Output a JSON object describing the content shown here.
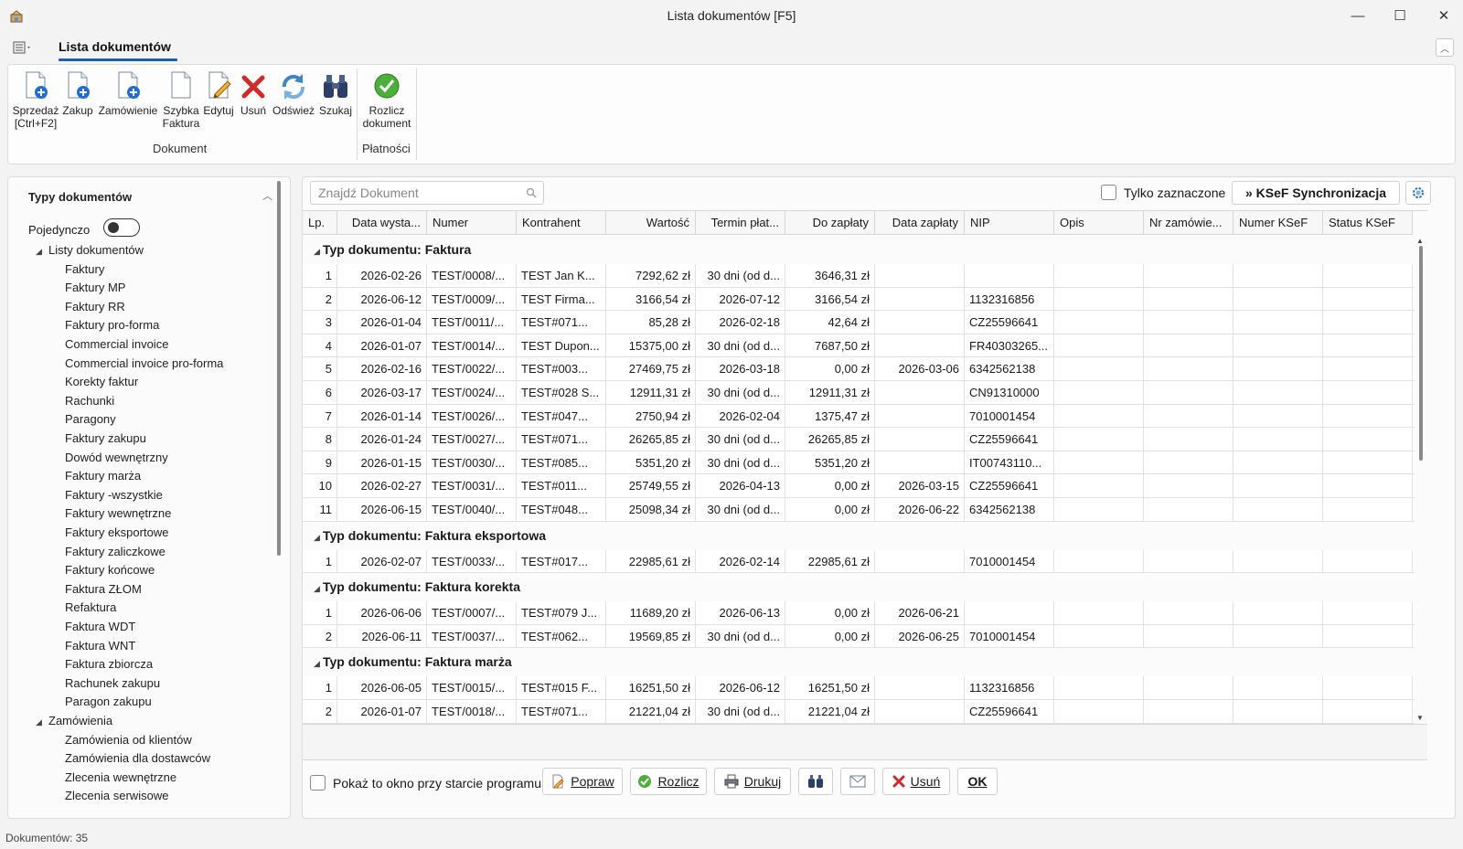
{
  "window": {
    "title": "Lista dokumentów [F5]",
    "minimize": "—",
    "maximize": "☐",
    "close": "✕"
  },
  "ribbon_tab": "Lista dokumentów",
  "ribbon": {
    "buttons": [
      {
        "label1": "Sprzedaż",
        "label2": "[Ctrl+F2]",
        "icon": "new-sale-document-icon"
      },
      {
        "label1": "Zakup",
        "label2": "",
        "icon": "new-purchase-document-icon"
      },
      {
        "label1": "Zamówienie",
        "label2": "",
        "icon": "new-order-document-icon"
      },
      {
        "label1": "Szybka",
        "label2": "Faktura",
        "icon": "blank-document-icon"
      },
      {
        "label1": "Edytuj",
        "label2": "",
        "icon": "edit-document-icon"
      },
      {
        "label1": "Usuń",
        "label2": "",
        "icon": "delete-x-icon"
      },
      {
        "label1": "Odśwież",
        "label2": "",
        "icon": "refresh-icon"
      },
      {
        "label1": "Szukaj",
        "label2": "",
        "icon": "binoculars-icon"
      },
      {
        "label1": "Rozlicz",
        "label2": "dokument",
        "icon": "green-check-icon"
      }
    ],
    "groups": {
      "document": "Dokument",
      "payments": "Płatności"
    }
  },
  "left_panel": {
    "title": "Typy dokumentów",
    "toggle_label": "Pojedynczo",
    "folders": [
      {
        "label": "Listy dokumentów",
        "items": [
          "Faktury",
          "Faktury MP",
          "Faktury RR",
          "Faktury pro-forma",
          "Commercial invoice",
          "Commercial invoice pro-forma",
          "Korekty faktur",
          "Rachunki",
          "Paragony",
          "Faktury zakupu",
          "Dowód wewnętrzny",
          "Faktury marża",
          "Faktury -wszystkie",
          "Faktury wewnętrzne",
          "Faktury eksportowe",
          "Faktury zaliczkowe",
          "Faktury końcowe",
          "Faktura ZŁOM",
          "Refaktura",
          "Faktura WDT",
          "Faktura WNT",
          "Faktura zbiorcza",
          "Rachunek zakupu",
          "Paragon zakupu"
        ]
      },
      {
        "label": "Zamówienia",
        "items": [
          "Zamówienia od klientów",
          "Zamówienia dla dostawców",
          "Zlecenia wewnętrzne",
          "Zlecenia serwisowe"
        ]
      }
    ]
  },
  "toolbar": {
    "search_placeholder": "Znajdź Dokument",
    "only_marked_label": "Tylko zaznaczone",
    "ksef_button": "» KSeF Synchronizacja"
  },
  "table": {
    "columns": [
      "Lp.",
      "Data wysta...",
      "Numer",
      "Kontrahent",
      "Wartość",
      "Termin płat...",
      "Do zapłaty",
      "Data zapłaty",
      "NIP",
      "Opis",
      "Nr zamówie...",
      "Numer KSeF",
      "Status KSeF"
    ],
    "groups": [
      {
        "title": "Typ dokumentu: Faktura",
        "rows": [
          [
            "1",
            "2026-02-26",
            "TEST/0008/...",
            "TEST Jan K...",
            "7292,62 zł",
            "30 dni (od d...",
            "3646,31 zł",
            "",
            "",
            "",
            "",
            "",
            ""
          ],
          [
            "2",
            "2026-06-12",
            "TEST/0009/...",
            "TEST Firma...",
            "3166,54 zł",
            "2026-07-12",
            "3166,54 zł",
            "",
            "1132316856",
            "",
            "",
            "",
            ""
          ],
          [
            "3",
            "2026-01-04",
            "TEST/0011/...",
            "TEST#071...",
            "85,28 zł",
            "2026-02-18",
            "42,64 zł",
            "",
            "CZ25596641",
            "",
            "",
            "",
            ""
          ],
          [
            "4",
            "2026-01-07",
            "TEST/0014/...",
            "TEST Dupon...",
            "15375,00 zł",
            "30 dni (od d...",
            "7687,50 zł",
            "",
            "FR40303265...",
            "",
            "",
            "",
            ""
          ],
          [
            "5",
            "2026-02-16",
            "TEST/0022/...",
            "TEST#003...",
            "27469,75 zł",
            "2026-03-18",
            "0,00 zł",
            "2026-03-06",
            "6342562138",
            "",
            "",
            "",
            ""
          ],
          [
            "6",
            "2026-03-17",
            "TEST/0024/...",
            "TEST#028 S...",
            "12911,31 zł",
            "30 dni (od d...",
            "12911,31 zł",
            "",
            "CN91310000",
            "",
            "",
            "",
            ""
          ],
          [
            "7",
            "2026-01-14",
            "TEST/0026/...",
            "TEST#047...",
            "2750,94 zł",
            "2026-02-04",
            "1375,47 zł",
            "",
            "7010001454",
            "",
            "",
            "",
            ""
          ],
          [
            "8",
            "2026-01-24",
            "TEST/0027/...",
            "TEST#071...",
            "26265,85 zł",
            "30 dni (od d...",
            "26265,85 zł",
            "",
            "CZ25596641",
            "",
            "",
            "",
            ""
          ],
          [
            "9",
            "2026-01-15",
            "TEST/0030/...",
            "TEST#085...",
            "5351,20 zł",
            "30 dni (od d...",
            "5351,20 zł",
            "",
            "IT00743110...",
            "",
            "",
            "",
            ""
          ],
          [
            "10",
            "2026-02-27",
            "TEST/0031/...",
            "TEST#011...",
            "25749,55 zł",
            "2026-04-13",
            "0,00 zł",
            "2026-03-15",
            "CZ25596641",
            "",
            "",
            "",
            ""
          ],
          [
            "11",
            "2026-06-15",
            "TEST/0040/...",
            "TEST#048...",
            "25098,34 zł",
            "30 dni (od d...",
            "0,00 zł",
            "2026-06-22",
            "6342562138",
            "",
            "",
            "",
            ""
          ]
        ]
      },
      {
        "title": "Typ dokumentu: Faktura eksportowa",
        "rows": [
          [
            "1",
            "2026-02-07",
            "TEST/0033/...",
            "TEST#017...",
            "22985,61 zł",
            "2026-02-14",
            "22985,61 zł",
            "",
            "7010001454",
            "",
            "",
            "",
            ""
          ]
        ]
      },
      {
        "title": "Typ dokumentu: Faktura korekta",
        "rows": [
          [
            "1",
            "2026-06-06",
            "TEST/0007/...",
            "TEST#079 J...",
            "11689,20 zł",
            "2026-06-13",
            "0,00 zł",
            "2026-06-21",
            "",
            "",
            "",
            "",
            ""
          ],
          [
            "2",
            "2026-06-11",
            "TEST/0037/...",
            "TEST#062...",
            "19569,85 zł",
            "30 dni (od d...",
            "0,00 zł",
            "2026-06-25",
            "7010001454",
            "",
            "",
            "",
            ""
          ]
        ]
      },
      {
        "title": "Typ dokumentu: Faktura marża",
        "rows": [
          [
            "1",
            "2026-06-05",
            "TEST/0015/...",
            "TEST#015 F...",
            "16251,50 zł",
            "2026-06-12",
            "16251,50 zł",
            "",
            "1132316856",
            "",
            "",
            "",
            ""
          ],
          [
            "2",
            "2026-01-07",
            "TEST/0018/...",
            "TEST#071...",
            "21221,04 zł",
            "30 dni (od d...",
            "21221,04 zł",
            "",
            "CZ25596641",
            "",
            "",
            "",
            ""
          ]
        ]
      }
    ]
  },
  "bottom": {
    "show_on_start_label": "Pokaż to okno przy starcie programu",
    "buttons": {
      "popraw": "Popraw",
      "rozlicz": "Rozlicz",
      "drukuj": "Drukuj",
      "usun": "Usuń",
      "ok": "OK"
    }
  },
  "status": "Dokumentów: 35"
}
